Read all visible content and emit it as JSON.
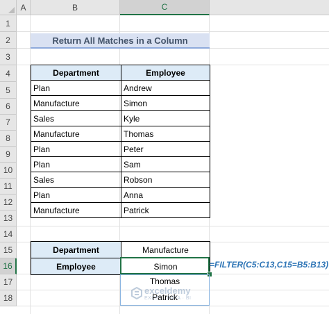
{
  "columns": [
    "A",
    "B",
    "C"
  ],
  "rows": [
    "1",
    "2",
    "3",
    "4",
    "5",
    "6",
    "7",
    "8",
    "9",
    "10",
    "11",
    "12",
    "13",
    "14",
    "15",
    "16",
    "17",
    "18"
  ],
  "title": "Return All Matches in a Column",
  "table": {
    "headers": [
      "Department",
      "Employee"
    ],
    "rows": [
      [
        "Plan",
        "Andrew"
      ],
      [
        "Manufacture",
        "Simon"
      ],
      [
        "Sales",
        "Kyle"
      ],
      [
        "Manufacture",
        "Thomas"
      ],
      [
        "Plan",
        "Peter"
      ],
      [
        "Plan",
        "Sam"
      ],
      [
        "Sales",
        "Robson"
      ],
      [
        "Plan",
        "Anna"
      ],
      [
        "Manufacture",
        "Patrick"
      ]
    ]
  },
  "criteria": {
    "department_label": "Department",
    "department_value": "Manufacture",
    "employee_label": "Employee",
    "employee_value": "Simon"
  },
  "spill": [
    "Thomas",
    "Patrick"
  ],
  "formula": "=FILTER(C5:C13,C15=B5:B13)",
  "watermark": {
    "name": "exceldemy",
    "tagline": "EXCEL · DATA · BI"
  },
  "colors": {
    "selection": "#217346",
    "header_fill": "#ddebf7",
    "title_fill": "#d9e1f2",
    "formula_text": "#2e75b6"
  }
}
